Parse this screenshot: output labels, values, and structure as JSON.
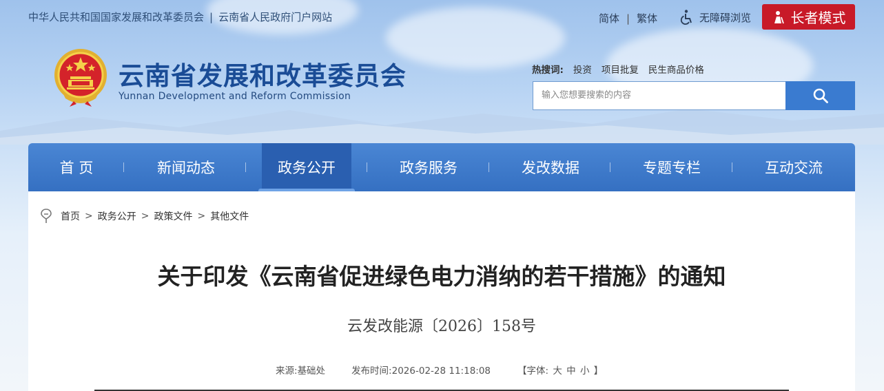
{
  "top_links": [
    "中华人民共和国国家发展和改革委员会",
    "云南省人民政府门户网站"
  ],
  "top_sep": "|",
  "lang": {
    "simplified": "简体",
    "bar": "|",
    "traditional": "繁体"
  },
  "accessibility": "无障碍浏览",
  "elder_mode": "长者模式",
  "site": {
    "title": "云南省发展和改革委员会",
    "subtitle": "Yunnan Development and Reform Commission"
  },
  "hot_search": {
    "label": "热搜词:",
    "items": [
      "投资",
      "项目批复",
      "民生商品价格"
    ]
  },
  "search": {
    "placeholder": "输入您想要搜索的内容"
  },
  "nav": [
    "首 页",
    "新闻动态",
    "政务公开",
    "政务服务",
    "发改数据",
    "专题专栏",
    "互动交流"
  ],
  "nav_active_index": 2,
  "breadcrumb": {
    "items": [
      "首页",
      "政务公开",
      "政策文件",
      "其他文件"
    ],
    "separator": ">"
  },
  "article": {
    "title": "关于印发《云南省促进绿色电力消纳的若干措施》的通知",
    "doc_number": "云发改能源〔2026〕158号",
    "source_label": "来源:",
    "source": "基础处",
    "time_label": "发布时间:",
    "time": "2026-02-28 11:18:08",
    "font_size_open": "【字体:",
    "font_sizes": [
      "大",
      "中",
      "小"
    ],
    "font_size_close": "】"
  },
  "colors": {
    "nav": "#3a78c9",
    "elder_button": "#c81a28",
    "title": "#1a4c96",
    "search_button": "#3a7bd0"
  }
}
